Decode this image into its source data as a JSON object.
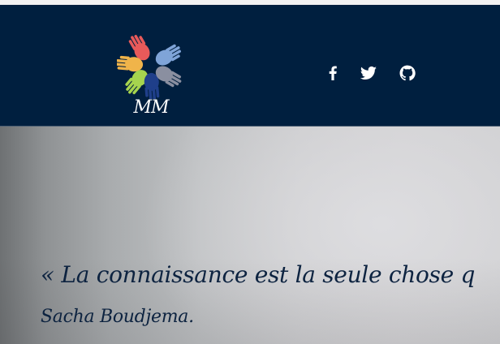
{
  "header": {
    "logo": {
      "text": "MM",
      "icon": "colored-hands-circle-logo",
      "hand_colors": [
        "#e85a5a",
        "#f0b44a",
        "#a6d44e",
        "#1f3f8a",
        "#7fa4d8",
        "#8a8fa0"
      ]
    },
    "social": [
      {
        "name": "facebook-icon"
      },
      {
        "name": "twitter-icon"
      },
      {
        "name": "github-icon"
      }
    ],
    "background": "#001f3f"
  },
  "hero": {
    "quote": "« La connaissance est la seule chose q",
    "author": "Sacha Boudjema."
  },
  "colors": {
    "text_dark": "#0d2340",
    "text_light": "#ffffff"
  }
}
